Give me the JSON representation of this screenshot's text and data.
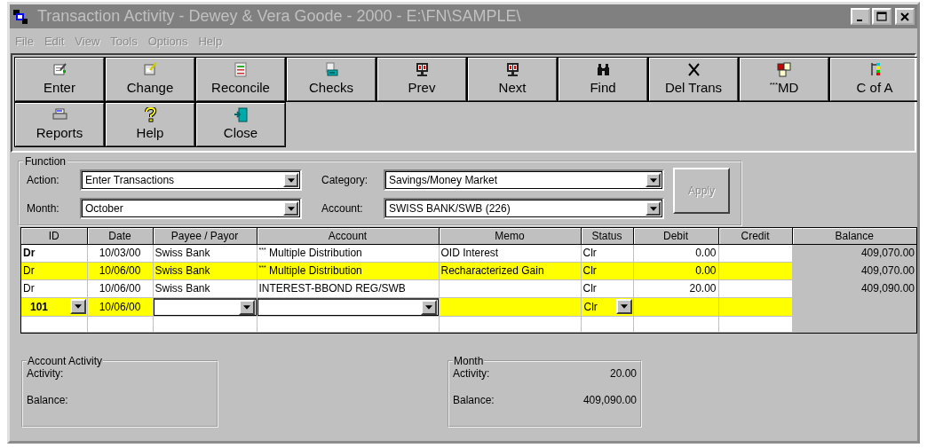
{
  "window": {
    "title": "Transaction Activity - Dewey & Vera Goode - 2000 - E:\\FN\\SAMPLE\\"
  },
  "menu": [
    {
      "label": "File",
      "disabled": true
    },
    {
      "label": "Edit",
      "disabled": true
    },
    {
      "label": "View",
      "disabled": true
    },
    {
      "label": "Tools",
      "disabled": true
    },
    {
      "label": "Options",
      "disabled": true
    },
    {
      "label": "Help",
      "disabled": true
    }
  ],
  "toolbar": [
    {
      "label": "Enter"
    },
    {
      "label": "Change"
    },
    {
      "label": "Reconcile"
    },
    {
      "label": "Checks"
    },
    {
      "label": "Prev"
    },
    {
      "label": "Next"
    },
    {
      "label": "Find"
    },
    {
      "label": "Del Trans"
    },
    {
      "label": "$^{***}$MD"
    },
    {
      "label": "C of A"
    },
    {
      "label": "Reports"
    },
    {
      "label": "Help"
    },
    {
      "label": "Close"
    }
  ],
  "function": {
    "title": "Function",
    "fields": [
      {
        "label": "Action:",
        "value": "Enter Transactions"
      },
      {
        "label": "Category:",
        "value": "Savings/Money Market"
      },
      {
        "label": "Month:",
        "value": "October"
      },
      {
        "label": "Account:",
        "value": "SWISS BANK/SWB (226)"
      }
    ],
    "apply": {
      "label": "Apply",
      "disabled": true
    }
  },
  "table": {
    "columns": [
      "ID",
      "Date",
      "Payee / Payor",
      "Account",
      "Memo",
      "Status",
      "Debit",
      "Credit",
      "Balance"
    ],
    "rows": [
      {
        "kind": "posted",
        "highlighted": false,
        "id_bold": true,
        "id": "Dr",
        "date": "10/03/00",
        "payee": "Swiss Bank",
        "account": "$^{***}$ Multiple Distribution",
        "memo": "OID Interest",
        "status": "Clr",
        "debit": "0.00",
        "balance": "409,070.00"
      },
      {
        "kind": "posted",
        "highlighted": true,
        "id_bold": false,
        "id": "Dr",
        "date": "10/06/00",
        "payee": "Swiss Bank",
        "account": "$^{***}$ Multiple Distribution",
        "memo": "Recharacterized Gain",
        "status": "Clr",
        "debit": "0.00",
        "balance": "409,070.00"
      },
      {
        "kind": "posted",
        "highlighted": false,
        "id_bold": false,
        "id": "Dr",
        "date": "10/06/00",
        "payee": "Swiss Bank",
        "account": "INTEREST-BBOND REG/SWB",
        "status": "Clr",
        "debit": "20.00",
        "balance": "409,090.00"
      },
      {
        "kind": "edit",
        "highlighted": true,
        "id_bold": true,
        "id": "101",
        "date": "10/06/00",
        "status": "Clr"
      }
    ]
  },
  "account_activity": {
    "title": "Account Activity",
    "rows": [
      {
        "label": "Activity:"
      },
      {
        "label": "Balance:"
      }
    ]
  },
  "month_summary": {
    "title": "Month",
    "rows": [
      {
        "label": "Activity:",
        "value": "20.00"
      },
      {
        "label": "Balance:",
        "value": "409,090.00"
      }
    ]
  }
}
